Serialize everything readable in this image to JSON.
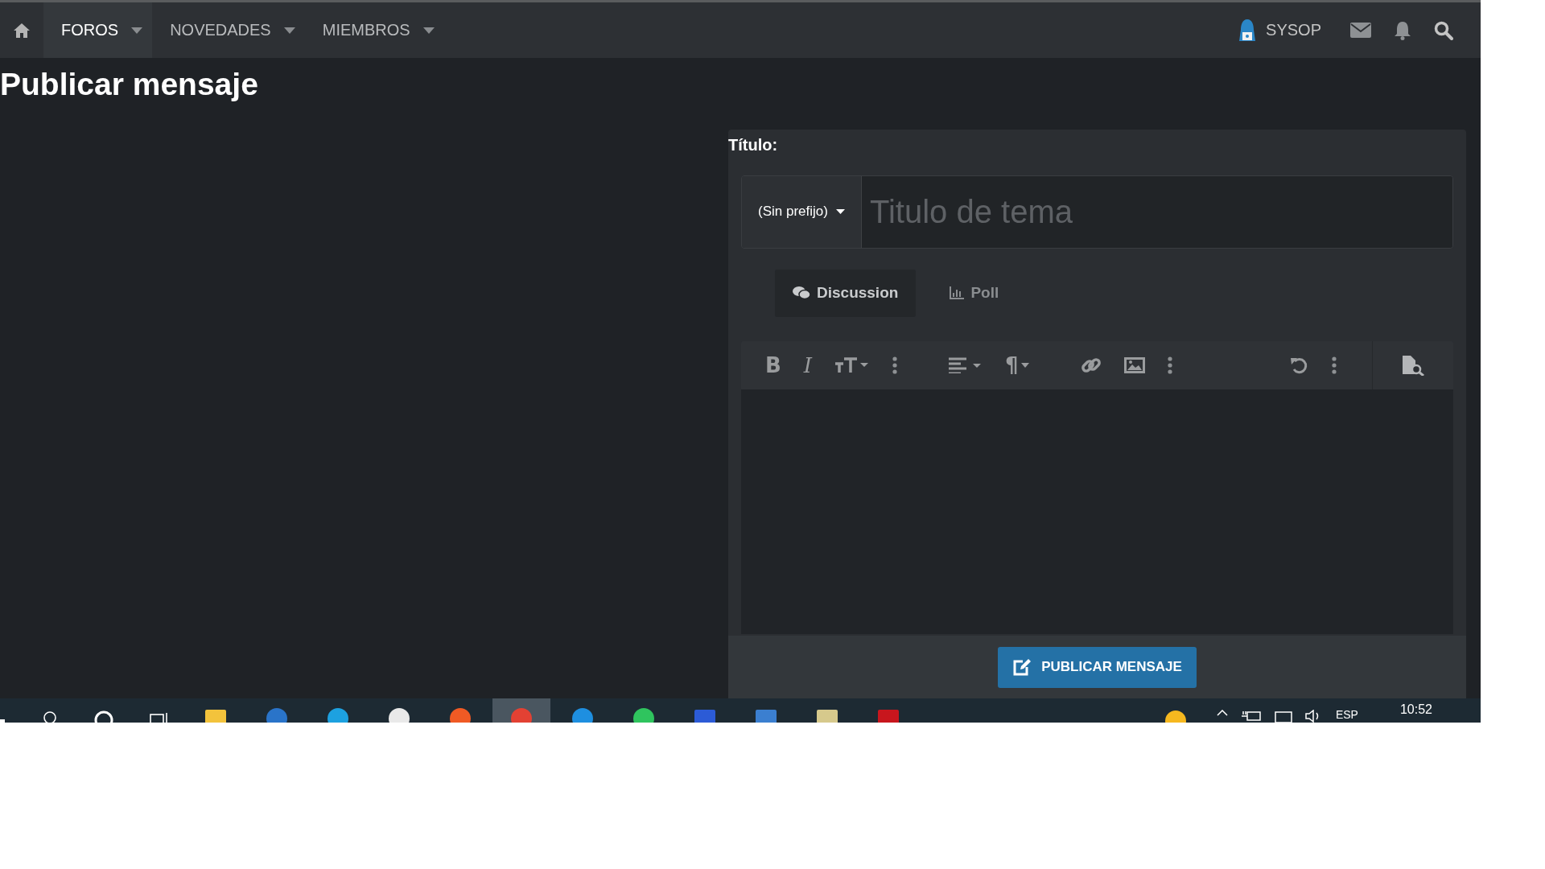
{
  "nav": {
    "items": [
      {
        "label": "FOROS",
        "selected": true
      },
      {
        "label": "NOVEDADES",
        "selected": false
      },
      {
        "label": "MIEMBROS",
        "selected": false
      }
    ],
    "user": "SYSOP"
  },
  "page_title": "Publicar mensaje",
  "form": {
    "title_label": "Título:",
    "prefix": "(Sin prefijo)",
    "title_field": {
      "placeholder": "Titulo de tema"
    },
    "types": [
      {
        "label": "Discussion",
        "selected": true
      },
      {
        "label": "Poll",
        "selected": false
      }
    ],
    "toolbar": {
      "bold": "B",
      "italic": "I",
      "paragraph": "¶"
    },
    "submit": "PUBLICAR MENSAJE"
  },
  "taskbar": {
    "apps": [
      {
        "selected": false
      },
      {
        "selected": false
      },
      {
        "selected": false
      },
      {
        "selected": false
      },
      {
        "selected": false
      },
      {
        "selected": true
      },
      {
        "selected": false
      },
      {
        "selected": false
      },
      {
        "selected": false
      },
      {
        "selected": false
      },
      {
        "selected": false
      },
      {
        "selected": false
      }
    ],
    "language": "ESP",
    "clock": "10:52"
  }
}
